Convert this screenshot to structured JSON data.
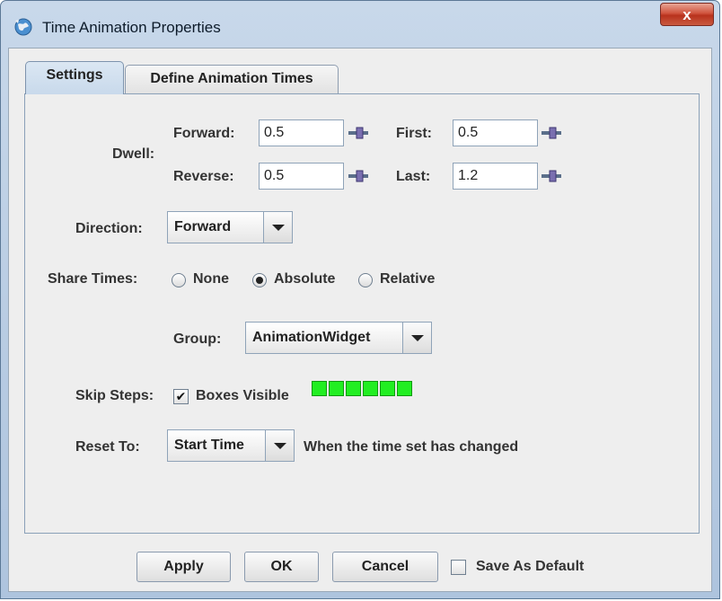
{
  "window": {
    "title": "Time Animation Properties",
    "close_glyph": "x",
    "icon": "globe-icon"
  },
  "tabs": [
    {
      "label": "Settings",
      "active": true
    },
    {
      "label": "Define Animation Times",
      "active": false
    }
  ],
  "settings": {
    "dwell_label": "Dwell:",
    "forward_label": "Forward:",
    "forward_value": "0.5",
    "reverse_label": "Reverse:",
    "reverse_value": "0.5",
    "first_label": "First:",
    "first_value": "0.5",
    "last_label": "Last:",
    "last_value": "1.2",
    "direction_label": "Direction:",
    "direction_value": "Forward",
    "share_label": "Share Times:",
    "share_options": [
      {
        "label": "None",
        "selected": false
      },
      {
        "label": "Absolute",
        "selected": true
      },
      {
        "label": "Relative",
        "selected": false
      }
    ],
    "group_label": "Group:",
    "group_value": "AnimationWidget",
    "skip_label": "Skip Steps:",
    "boxes_visible_label": "Boxes Visible",
    "boxes_visible_checked": true,
    "step_box_count": 6,
    "step_box_color": "#22ee22",
    "reset_label": "Reset To:",
    "reset_value": "Start Time",
    "reset_note": "When the time set has changed"
  },
  "buttons": {
    "apply": "Apply",
    "ok": "OK",
    "cancel": "Cancel",
    "save_default": "Save As Default",
    "save_default_checked": false
  }
}
